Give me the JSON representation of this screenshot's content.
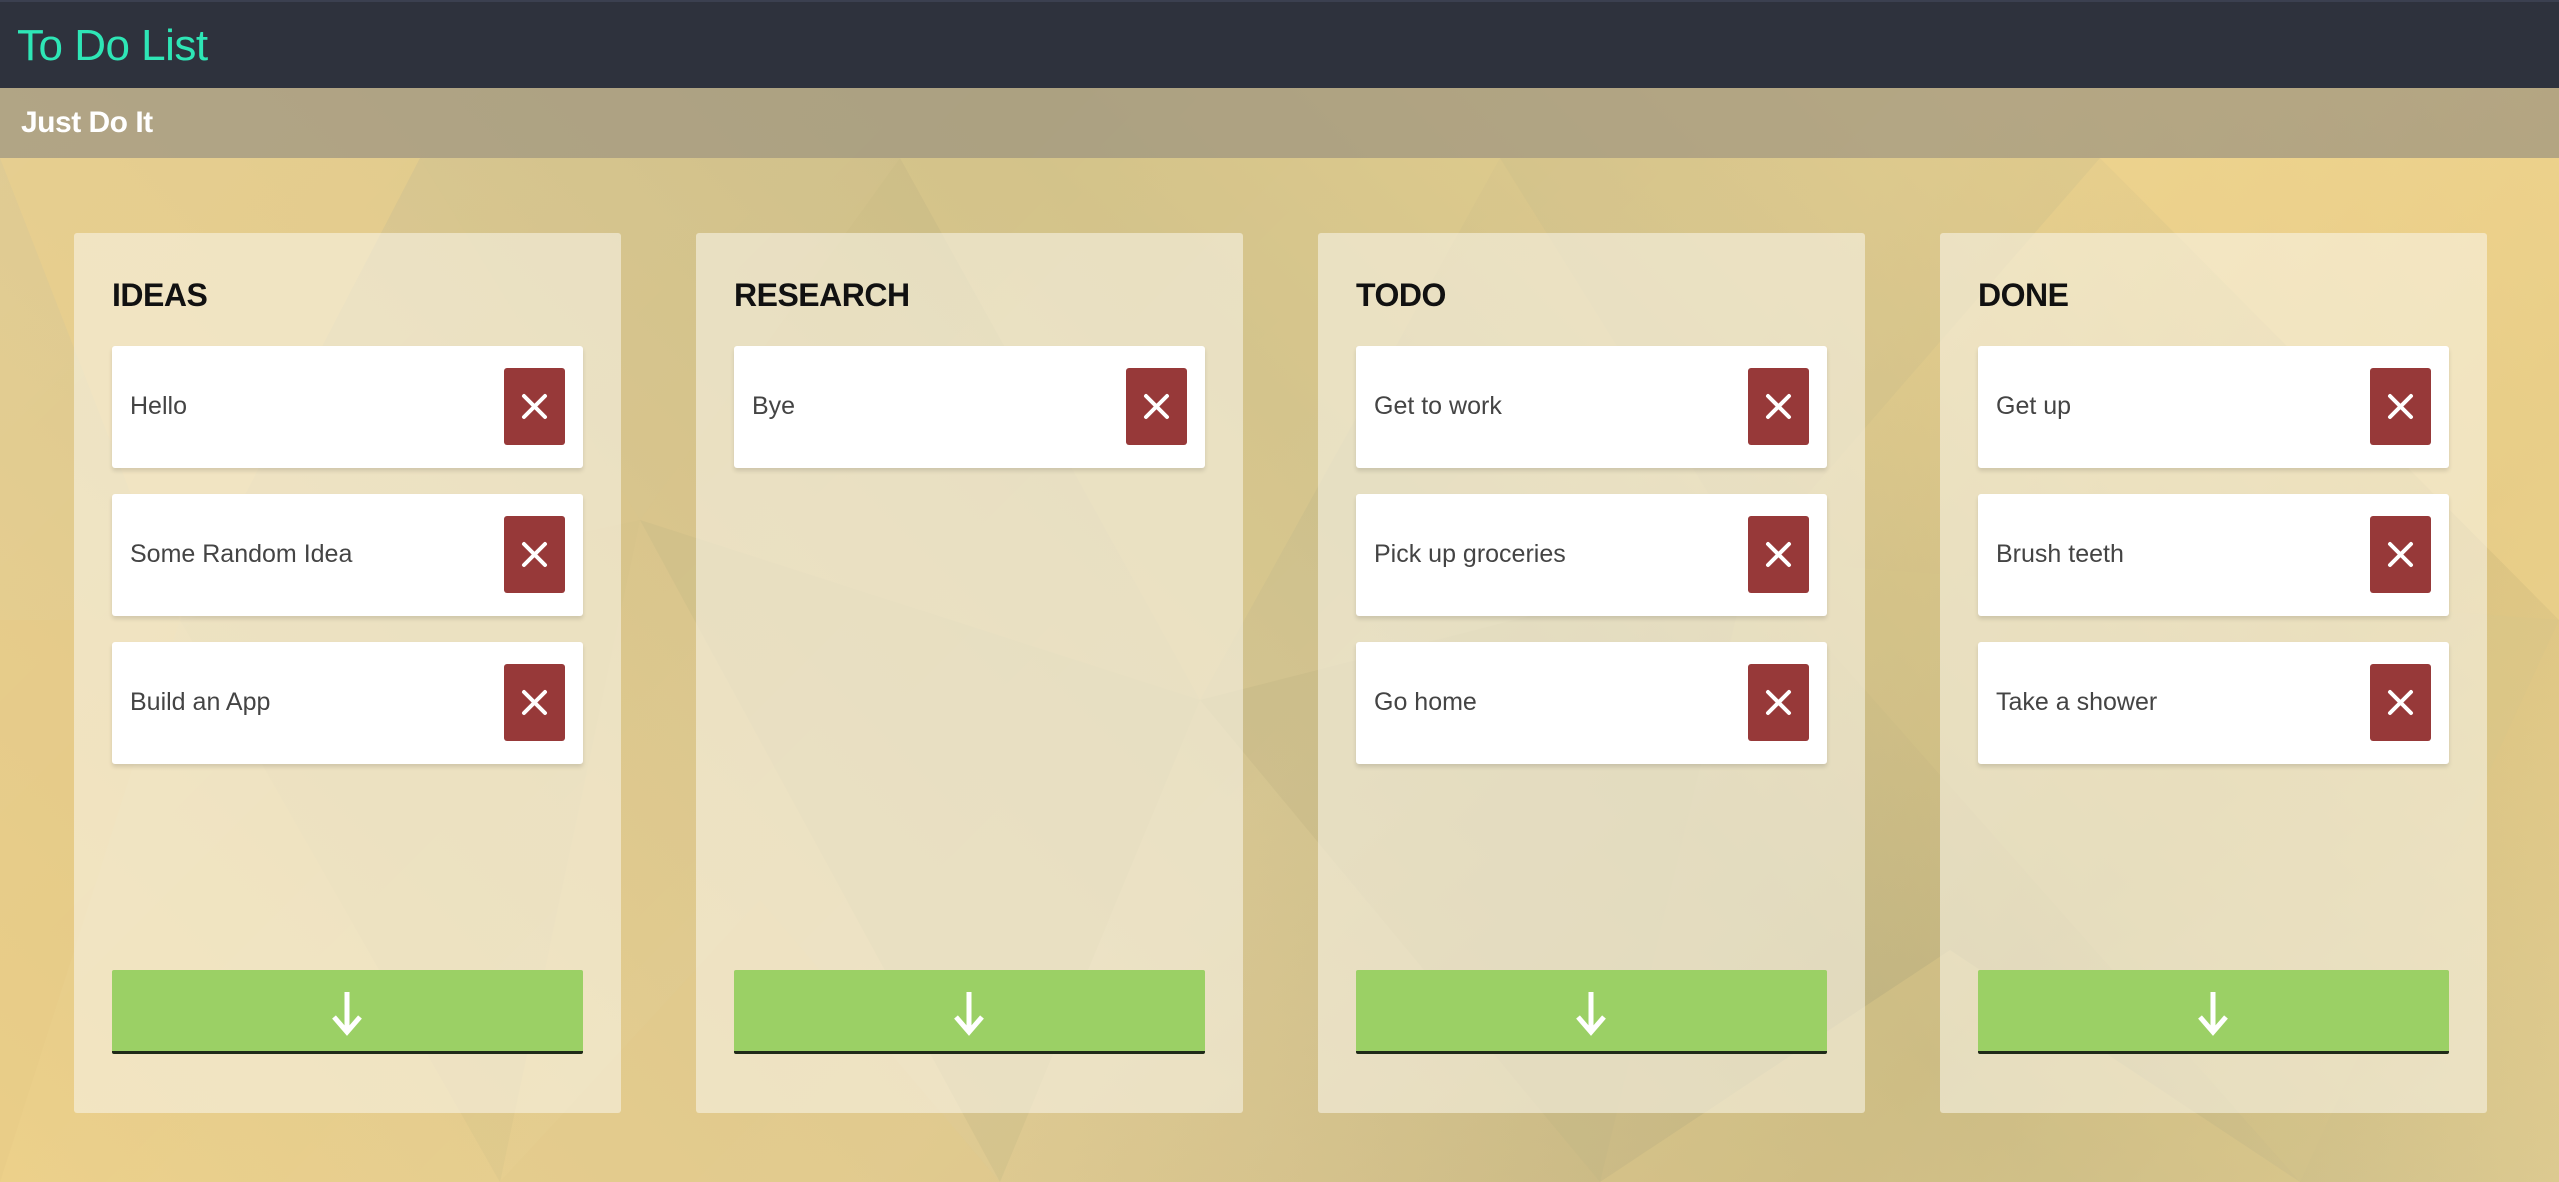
{
  "app": {
    "title": "To Do List",
    "subtitle": "Just Do It"
  },
  "colors": {
    "header_bg": "#2e323d",
    "title_accent": "#2ee6b6",
    "delete_button": "#973939",
    "add_button": "#9bd065"
  },
  "icons": {
    "delete": "close-x-icon",
    "add": "arrow-down-icon"
  },
  "columns": [
    {
      "title": "IDEAS",
      "cards": [
        "Hello",
        "Some Random Idea",
        "Build an App"
      ]
    },
    {
      "title": "RESEARCH",
      "cards": [
        "Bye"
      ]
    },
    {
      "title": "TODO",
      "cards": [
        "Get to work",
        "Pick up groceries",
        "Go home"
      ]
    },
    {
      "title": "DONE",
      "cards": [
        "Get up",
        "Brush teeth",
        "Take a shower"
      ]
    }
  ]
}
